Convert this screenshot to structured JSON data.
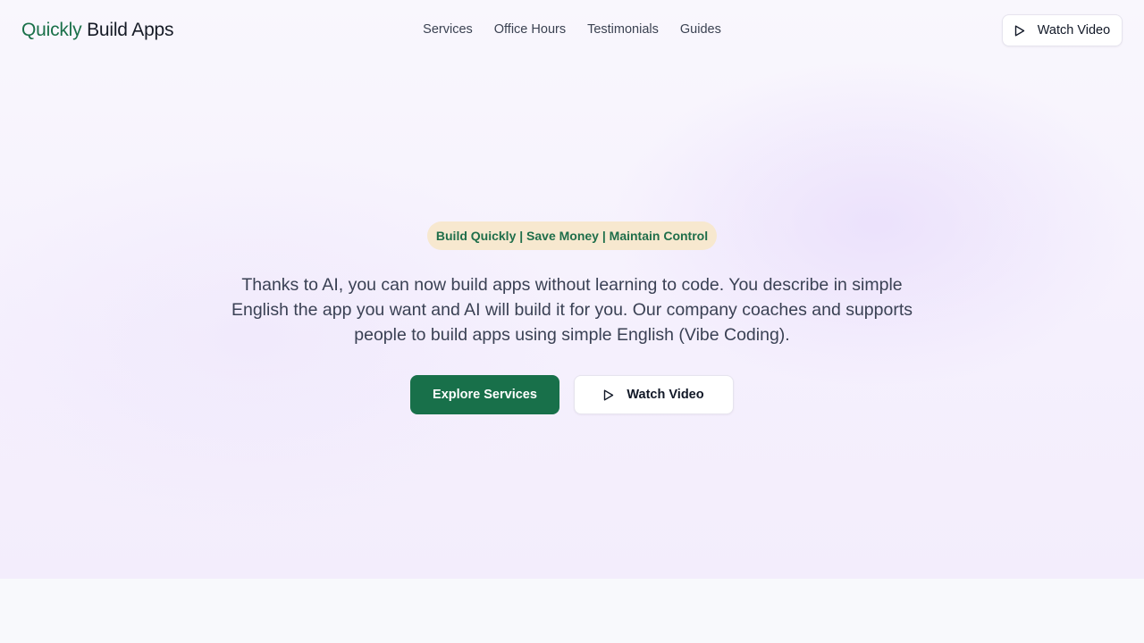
{
  "brand": {
    "accent": "Quickly",
    "rest": " Build Apps"
  },
  "nav": {
    "items": [
      {
        "label": "Services"
      },
      {
        "label": "Office Hours"
      },
      {
        "label": "Testimonials"
      },
      {
        "label": "Guides"
      }
    ]
  },
  "header": {
    "watch_label": "Watch Video",
    "watch_icon": "play-icon"
  },
  "hero": {
    "badge": "Build Quickly | Save Money | Maintain Control",
    "description": "Thanks to AI, you can now build apps without learning to code. You describe in simple English the app you want and AI will build it for you. Our company coaches and supports people to build apps using simple English (Vibe Coding).",
    "primary_cta": "Explore Services",
    "secondary_cta": "Watch Video",
    "secondary_icon": "play-icon"
  },
  "colors": {
    "brand_green": "#18704a",
    "badge_bg": "#f7e8cf",
    "hero_bg": "#f5f0fd",
    "text": "#3a4154"
  }
}
